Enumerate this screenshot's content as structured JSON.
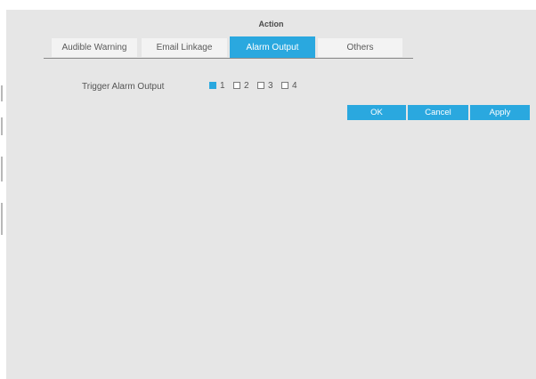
{
  "dialog": {
    "title": "Action"
  },
  "tabs": [
    {
      "label": "Audible Warning",
      "active": false
    },
    {
      "label": "Email Linkage",
      "active": false
    },
    {
      "label": "Alarm Output",
      "active": true
    },
    {
      "label": "Others",
      "active": false
    }
  ],
  "trigger_alarm_output": {
    "label": "Trigger Alarm Output",
    "options": [
      {
        "label": "1",
        "checked": true
      },
      {
        "label": "2",
        "checked": false
      },
      {
        "label": "3",
        "checked": false
      },
      {
        "label": "4",
        "checked": false
      }
    ]
  },
  "buttons": {
    "ok": "OK",
    "cancel": "Cancel",
    "apply": "Apply"
  },
  "colors": {
    "accent": "#2aa8df",
    "panel_background": "#e6e6e6",
    "tab_inactive": "#f3f3f3"
  }
}
